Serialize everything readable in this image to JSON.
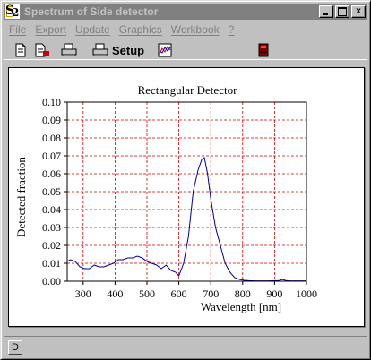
{
  "window": {
    "title": "Spectrum of Side detector",
    "app_icon": "S2"
  },
  "title_buttons": {
    "minimize": "",
    "maximize": "",
    "close": "x"
  },
  "menu": [
    {
      "label": "File"
    },
    {
      "label": "Export"
    },
    {
      "label": "Update"
    },
    {
      "label": "Graphics"
    },
    {
      "label": "Workbook"
    },
    {
      "label": "?"
    }
  ],
  "toolbar": {
    "setup_label": "Setup",
    "icons": [
      "document-icon",
      "document-export-icon",
      "printer-icon",
      "printer-setup-icon",
      "graph-icon",
      "device-icon"
    ]
  },
  "colors": {
    "line": "#00008b",
    "grid": "#cc0000",
    "face": "#c0c0c0"
  },
  "status": {
    "pane_label": "D"
  },
  "chart_data": {
    "type": "line",
    "title": "Rectangular Detector",
    "xlabel": "Wavelength [nm]",
    "ylabel": "Detected fraction",
    "xlim": [
      250,
      1000
    ],
    "ylim": [
      0,
      0.1
    ],
    "grid": true,
    "xticks": [
      300,
      400,
      500,
      600,
      700,
      800,
      900,
      1000
    ],
    "yticks": [
      "0.00",
      "0.01",
      "0.02",
      "0.03",
      "0.04",
      "0.05",
      "0.06",
      "0.07",
      "0.08",
      "0.09",
      "0.10"
    ],
    "series": [
      {
        "x": [
          250,
          260,
          275,
          290,
          305,
          320,
          335,
          350,
          365,
          380,
          395,
          410,
          425,
          440,
          455,
          470,
          485,
          500,
          515,
          530,
          545,
          560,
          575,
          590,
          600,
          615,
          630,
          645,
          660,
          672,
          680,
          690,
          700,
          715,
          730,
          745,
          760,
          775,
          790,
          805,
          820,
          840,
          860,
          880,
          900,
          915,
          925,
          935,
          950,
          970,
          1000
        ],
        "y": [
          0.011,
          0.012,
          0.011,
          0.008,
          0.007,
          0.007,
          0.009,
          0.008,
          0.008,
          0.009,
          0.01,
          0.012,
          0.012,
          0.013,
          0.013,
          0.014,
          0.013,
          0.011,
          0.01,
          0.009,
          0.007,
          0.009,
          0.006,
          0.005,
          0.003,
          0.01,
          0.025,
          0.05,
          0.062,
          0.068,
          0.069,
          0.06,
          0.046,
          0.03,
          0.02,
          0.01,
          0.005,
          0.002,
          0.001,
          0.0005,
          0.0003,
          0.0002,
          0.0002,
          0.0002,
          0.0003,
          0.0004,
          0.001,
          0.0004,
          0.0002,
          0.0002,
          0.0002
        ]
      }
    ]
  }
}
